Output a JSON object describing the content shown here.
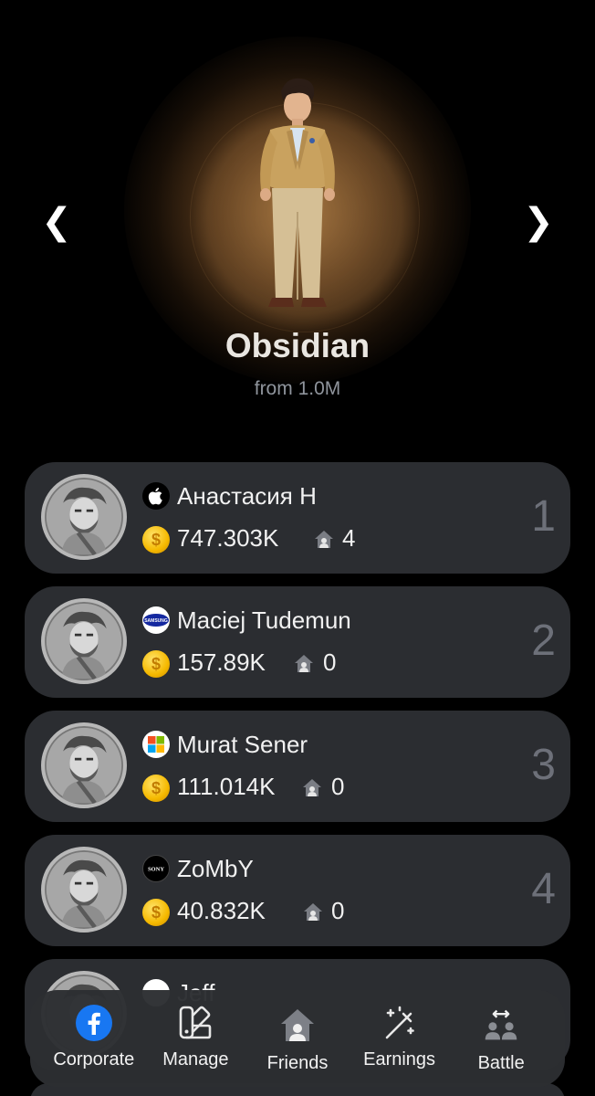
{
  "hero": {
    "prev_label": "❮",
    "next_label": "❯",
    "level_name": "Obsidian",
    "level_threshold": "from 1.0M"
  },
  "leaderboard": [
    {
      "name": "Анастасия Н",
      "brand_icon": "apple-icon",
      "coins": "747.303K",
      "friends": "4",
      "rank": "1"
    },
    {
      "name": "Maciej Tudemun",
      "brand_icon": "samsung-icon",
      "coins": "157.89K",
      "friends": "0",
      "rank": "2"
    },
    {
      "name": "Murat Sener",
      "brand_icon": "microsoft-icon",
      "coins": "111.014K",
      "friends": "0",
      "rank": "3"
    },
    {
      "name": "ZoMbY",
      "brand_icon": "sony-icon",
      "coins": "40.832K",
      "friends": "0",
      "rank": "4"
    },
    {
      "name": "Jeff",
      "brand_icon": "brand-icon",
      "coins": "",
      "friends": "",
      "rank": ""
    }
  ],
  "brand_text": {
    "samsung": "SAMSUNG",
    "sony": "SONY"
  },
  "coin_symbol": "$",
  "bottom_nav": [
    {
      "label": "Corporate",
      "icon": "facebook-icon"
    },
    {
      "label": "Manage",
      "icon": "palette-icon"
    },
    {
      "label": "Friends",
      "icon": "house-friends-icon"
    },
    {
      "label": "Earnings",
      "icon": "magic-wand-icon"
    },
    {
      "label": "Battle",
      "icon": "battle-icon"
    }
  ],
  "colors": {
    "background": "#000000",
    "card": "#2b2d31",
    "rank_text": "#6d7079",
    "coin": "#f5b900",
    "facebook": "#1877f2"
  }
}
